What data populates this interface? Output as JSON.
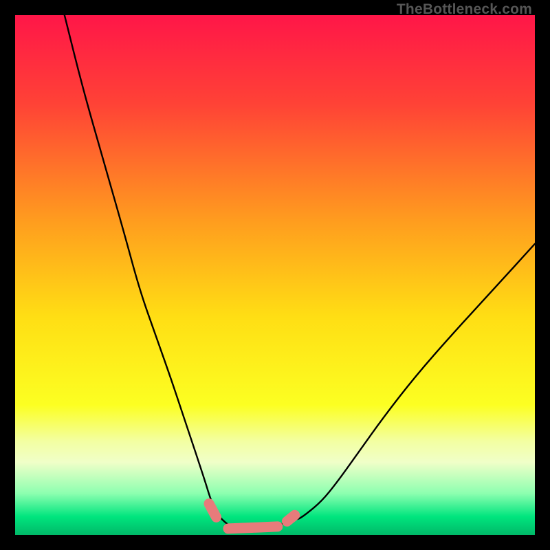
{
  "attribution": "TheBottleneck.com",
  "chart_data": {
    "type": "line",
    "title": "",
    "xlabel": "",
    "ylabel": "",
    "xlim": [
      0,
      100
    ],
    "ylim": [
      0,
      100
    ],
    "gradient_stops": [
      {
        "offset": 0.0,
        "color": "#ff1648"
      },
      {
        "offset": 0.17,
        "color": "#ff4236"
      },
      {
        "offset": 0.4,
        "color": "#ff9e1e"
      },
      {
        "offset": 0.58,
        "color": "#ffde14"
      },
      {
        "offset": 0.75,
        "color": "#fcff22"
      },
      {
        "offset": 0.82,
        "color": "#f3ffa2"
      },
      {
        "offset": 0.86,
        "color": "#f0ffc8"
      },
      {
        "offset": 0.92,
        "color": "#8dffb0"
      },
      {
        "offset": 0.965,
        "color": "#00e57e"
      },
      {
        "offset": 1.0,
        "color": "#00b968"
      }
    ],
    "series": [
      {
        "name": "bottleneck-curve",
        "color": "#000000",
        "x": [
          9.5,
          13,
          17,
          21,
          24,
          27,
          30,
          32,
          34,
          35.5,
          36.7,
          37.5,
          38.3,
          39.2,
          40.5,
          42,
          43.5,
          45,
          46.7,
          48.5,
          50,
          51,
          51.5,
          52.5,
          53,
          53.6,
          54.2,
          56,
          59,
          62,
          66,
          71,
          77,
          84,
          92,
          100
        ],
        "y": [
          100,
          86,
          72,
          58,
          47,
          38.5,
          30,
          24,
          18,
          13.5,
          9.8,
          7.2,
          5.2,
          3.6,
          2.3,
          1.3,
          0.8,
          0.6,
          0.6,
          0.9,
          1.4,
          1.9,
          2.2,
          3.0,
          3.6,
          3.5,
          2.8,
          4.0,
          6.5,
          10.2,
          15.8,
          22.8,
          30.5,
          38.5,
          47.2,
          56.0
        ]
      },
      {
        "name": "highlight-segments",
        "color": "#e77b7b",
        "segments": [
          {
            "x": [
              37.3,
              38.7
            ],
            "y": [
              6.0,
              3.4
            ]
          },
          {
            "x": [
              41.0,
              50.5
            ],
            "y": [
              1.2,
              1.6
            ]
          },
          {
            "x": [
              52.3,
              53.8
            ],
            "y": [
              2.6,
              3.8
            ]
          }
        ]
      }
    ]
  }
}
